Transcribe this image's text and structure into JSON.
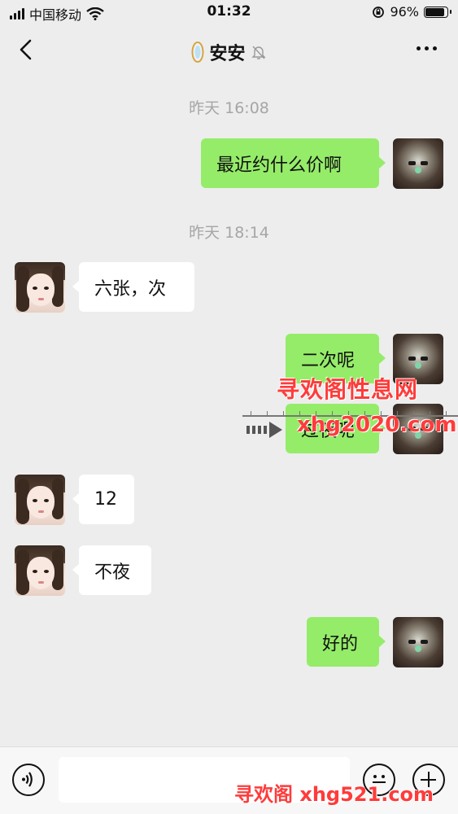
{
  "status_bar": {
    "carrier": "中国移动",
    "time": "01:32",
    "battery_level": "96%",
    "battery_fraction": 0.96,
    "icons": [
      "signal-icon",
      "wifi-icon",
      "orientation-lock-icon",
      "battery-icon"
    ]
  },
  "nav": {
    "title": "安安",
    "icons": [
      "back-arrow-icon",
      "mirror-icon",
      "mute-bell-icon",
      "more-icon"
    ]
  },
  "messages": [
    {
      "type": "timestamp",
      "text": "昨天 16:08"
    },
    {
      "type": "message",
      "sender": "self",
      "text": "最近约什么价啊"
    },
    {
      "type": "timestamp",
      "text": "昨天 18:14"
    },
    {
      "type": "message",
      "sender": "other",
      "text": "六张，次"
    },
    {
      "type": "message",
      "sender": "self",
      "text": "二次呢"
    },
    {
      "type": "message",
      "sender": "self",
      "text": "过夜呢"
    },
    {
      "type": "message",
      "sender": "other",
      "text": "12"
    },
    {
      "type": "message",
      "sender": "other",
      "text": "不夜"
    },
    {
      "type": "message",
      "sender": "self",
      "text": "好的"
    }
  ],
  "watermarks": {
    "line1": "寻欢阁性息网",
    "line2": "xhg2020.com",
    "bottom": "寻欢阁 xhg521.com"
  },
  "input_bar": {
    "placeholder": "",
    "value": "",
    "icons": [
      "voice-icon",
      "emoji-icon",
      "add-icon"
    ]
  },
  "colors": {
    "background": "#ededed",
    "self_bubble": "#95ec69",
    "other_bubble": "#ffffff",
    "timestamp": "#a6a6a6",
    "watermark": "#ff3b3b"
  }
}
